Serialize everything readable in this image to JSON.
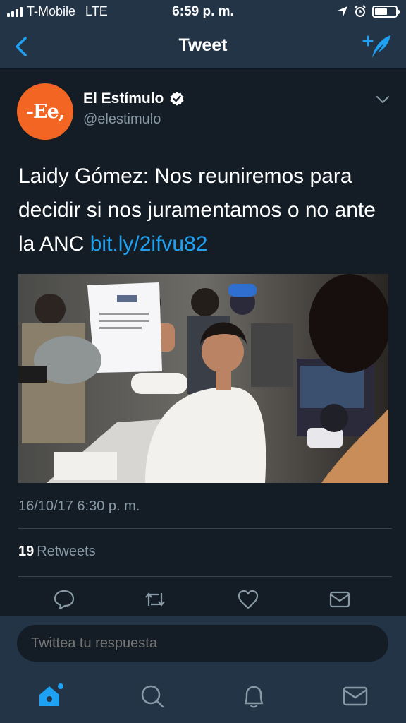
{
  "status_bar": {
    "carrier": "T-Mobile",
    "network": "LTE",
    "time": "6:59 p. m."
  },
  "nav": {
    "title": "Tweet",
    "back_icon": "chevron-left-icon",
    "compose_icon": "compose-tweet-icon"
  },
  "tweet": {
    "author_name": "El Estímulo",
    "author_handle": "@elestimulo",
    "avatar_text": "-Ee,",
    "verified": true,
    "text": "Laidy Gómez: Nos reuniremos para decidir si nos juramentamos o no ante la ANC ",
    "link": "bit.ly/2ifvu82",
    "timestamp": "16/10/17 6:30 p. m.",
    "retweet_count": "19",
    "retweet_label": "Retweets"
  },
  "actions": [
    "reply-icon",
    "retweet-icon",
    "like-icon",
    "share-icon"
  ],
  "reply": {
    "placeholder": "Twittea tu respuesta"
  },
  "tabbar": {
    "items": [
      "home-icon",
      "search-icon",
      "notifications-icon",
      "messages-icon"
    ],
    "active": "home-icon"
  },
  "colors": {
    "background": "#141d26",
    "bar": "#243447",
    "accent": "#1da1f2",
    "secondary_text": "#8899a6",
    "avatar": "#f26522"
  }
}
